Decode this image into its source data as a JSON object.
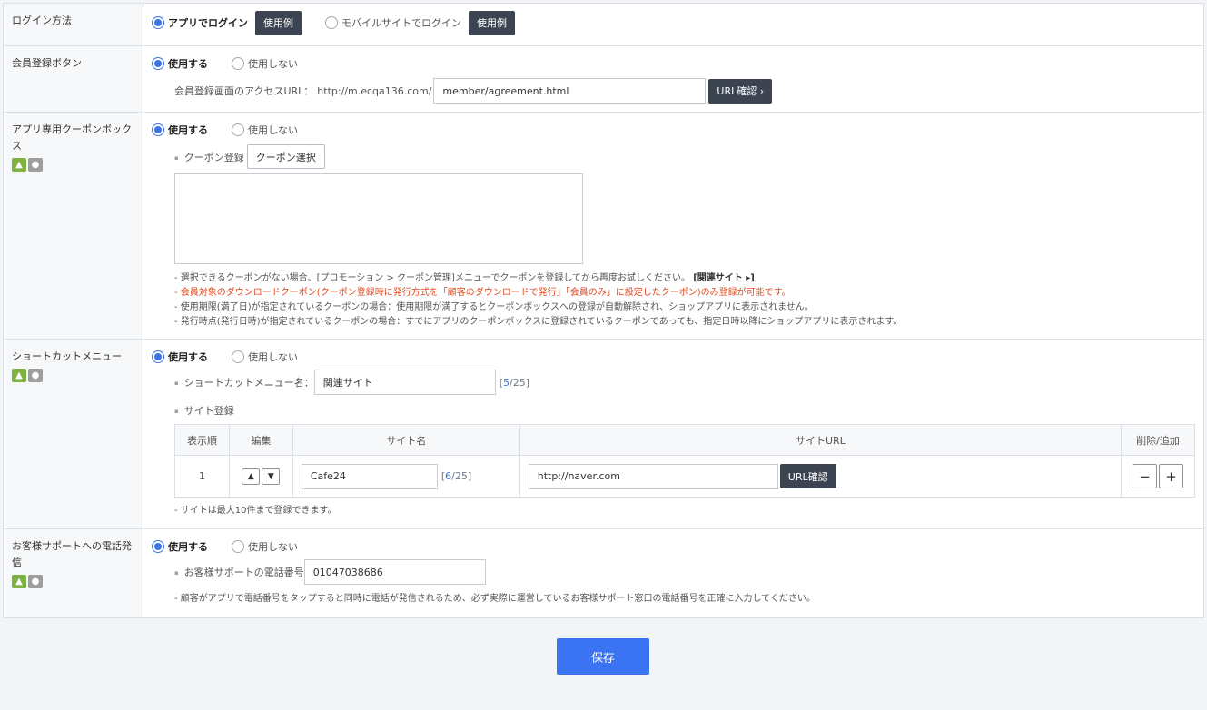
{
  "login": {
    "label": "ログイン方法",
    "option_app": "アプリでログイン",
    "example_1": "使用例",
    "option_mobile": "モバイルサイトでログイン",
    "example_2": "使用例"
  },
  "member_button": {
    "label": "会員登録ボタン",
    "use": "使用する",
    "not_use": "使用しない",
    "url_label": "会員登録画面のアクセスURL：",
    "url_prefix": "http://m.ecqa136.com/",
    "url_value": "member/agreement.html",
    "url_check": "URL確認 ›"
  },
  "coupon_box": {
    "label": "アプリ専用クーポンボックス",
    "use": "使用する",
    "not_use": "使用しない",
    "register_label": "クーポン登録",
    "select_button": "クーポン選択",
    "notes": [
      "- 選択できるクーポンがない場合、[プロモーション > クーポン管理]メニューでクーポンを登録してから再度お試しください。",
      "- 会員対象のダウンロードクーポン(クーポン登録時に発行方式を「顧客のダウンロードで発行」「会員のみ」に設定したクーポン)のみ登録が可能です。",
      "- 使用期限(満了日)が指定されているクーポンの場合：使用期限が満了するとクーポンボックスへの登録が自動解除され、ショップアプリに表示されません。",
      "- 発行時点(発行日時)が指定されているクーポンの場合：すでにアプリのクーポンボックスに登録されているクーポンであっても、指定日時以降にショップアプリに表示されます。"
    ],
    "related_link": "[関連サイト ▸]"
  },
  "shortcut": {
    "label": "ショートカットメニュー",
    "use": "使用する",
    "not_use": "使用しない",
    "name_label": "ショートカットメニュー名：",
    "name_value": "関連サイト",
    "name_count": "5",
    "name_max": "25",
    "site_register_label": "サイト登録",
    "table": {
      "headers": [
        "表示順",
        "編集",
        "サイト名",
        "サイトURL",
        "削除/追加"
      ],
      "rows": [
        {
          "order": "1",
          "site_name": "Cafe24",
          "name_count": "6",
          "name_max": "25",
          "url": "http://naver.com",
          "url_check": "URL確認"
        }
      ]
    },
    "note": "- サイトは最大10件まで登録できます。"
  },
  "phone": {
    "label": "お客様サポートへの電話発信",
    "use": "使用する",
    "not_use": "使用しない",
    "phone_label": "お客様サポートの電話番号",
    "phone_value": "01047038686",
    "note": "- 顧客がアプリで電話番号をタップすると同時に電話が発信されるため、必ず実際に運営しているお客様サポート窓口の電話番号を正確に入力してください。"
  },
  "save_label": "保存",
  "colors": {
    "accent": "#3b74f2",
    "dark_button": "#3d4451",
    "warning": "#e0491f"
  },
  "icons": {
    "android": "android-icon",
    "apple": "apple-icon"
  }
}
